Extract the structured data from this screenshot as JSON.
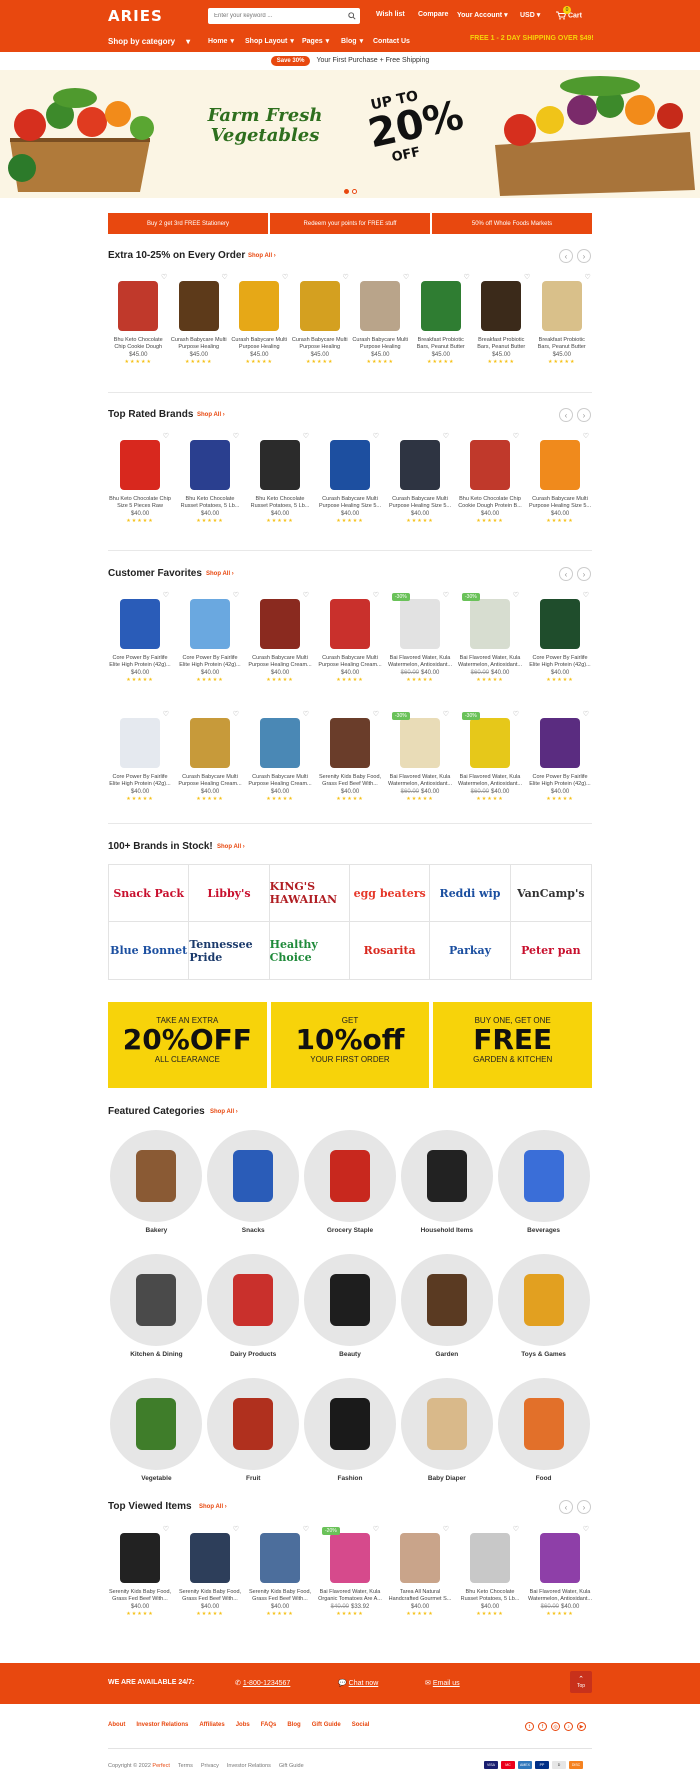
{
  "header": {
    "logo": "ARIES",
    "search_placeholder": "Enter your keyword ...",
    "links": [
      "Wish list",
      "Compare",
      "Your Account",
      "USD",
      "Cart"
    ],
    "cart_count": "0",
    "nav": [
      "Shop by category",
      "Home",
      "Shop Layout",
      "Pages",
      "Blog",
      "Contact Us"
    ],
    "shipping": "FREE 1 - 2 DAY SHIPPING OVER $49!"
  },
  "promo": {
    "badge": "Save 30%",
    "text": "Your First Purchase + Free Shipping"
  },
  "hero": {
    "line1": "Farm Fresh",
    "line2": "Vegetables",
    "up": "UP TO",
    "pct": "20%",
    "off": "OFF"
  },
  "tabs": [
    "Buy 2 get 3rd FREE Stationery",
    "Redeem your points for FREE stuff",
    "50% off Whole Foods Markets"
  ],
  "sections": {
    "extra": {
      "title": "Extra 10-25% on Every Order",
      "shop_all": "Shop All"
    },
    "top_rated": {
      "title": "Top Rated Brands",
      "shop_all": "Shop All"
    },
    "favorites": {
      "title": "Customer Favorites",
      "shop_all": "Shop All"
    },
    "brands": {
      "title": "100+ Brands in Stock!",
      "shop_all": "Shop All"
    },
    "featured": {
      "title": "Featured Categories",
      "shop_all": "Shop All"
    },
    "viewed": {
      "title": "Top Viewed Items",
      "shop_all": "Shop All"
    }
  },
  "row1": [
    {
      "name": "Bhu Keto Chocolate Chip Cookie Dough Protein B...",
      "price": "$45.00",
      "old": "",
      "badge": "",
      "color": "#c0392b"
    },
    {
      "name": "Curash Babycare Multi Purpose Healing Cream...",
      "price": "$45.00",
      "old": "",
      "badge": "",
      "color": "#5d3a1a"
    },
    {
      "name": "Curash Babycare Multi Purpose Healing Cream...",
      "price": "$45.00",
      "old": "",
      "badge": "",
      "color": "#e6a817"
    },
    {
      "name": "Curash Babycare Multi Purpose Healing Cream...",
      "price": "$45.00",
      "old": "",
      "badge": "",
      "color": "#d4a020"
    },
    {
      "name": "Curash Babycare Multi Purpose Healing Cream...",
      "price": "$45.00",
      "old": "",
      "badge": "",
      "color": "#b9a48a"
    },
    {
      "name": "Breakfast Probiotic Bars, Peanut Butter Dark...",
      "price": "$45.00",
      "old": "",
      "badge": "",
      "color": "#2f7d32"
    },
    {
      "name": "Breakfast Probiotic Bars, Peanut Butter Dark...",
      "price": "$45.00",
      "old": "",
      "badge": "",
      "color": "#3b2a1a"
    },
    {
      "name": "Breakfast Probiotic Bars, Peanut Butter Dark...",
      "price": "$45.00",
      "old": "",
      "badge": "",
      "color": "#d9c08a"
    }
  ],
  "row2": [
    {
      "name": "Bhu Keto Chocolate Chip Size 5 Pieces Raw (85g)...",
      "price": "$40.00",
      "old": "",
      "badge": "",
      "color": "#d8281e"
    },
    {
      "name": "Bhu Keto Chocolate Russet Potatoes, 5 Lb...",
      "price": "$40.00",
      "old": "",
      "badge": "",
      "color": "#2a3f8f"
    },
    {
      "name": "Bhu Keto Chocolate Russet Potatoes, 5 Lb...",
      "price": "$40.00",
      "old": "",
      "badge": "",
      "color": "#2b2b2b"
    },
    {
      "name": "Curash Babycare Multi Purpose Healing Size 5...",
      "price": "$40.00",
      "old": "",
      "badge": "",
      "color": "#1d4fa0"
    },
    {
      "name": "Curash Babycare Multi Purpose Healing Size 5...",
      "price": "$40.00",
      "old": "",
      "badge": "",
      "color": "#2e3442"
    },
    {
      "name": "Bhu Keto Chocolate Chip Cookie Dough Protein B...",
      "price": "$40.00",
      "old": "",
      "badge": "",
      "color": "#c0392b"
    },
    {
      "name": "Curash Babycare Multi Purpose Healing Size 5...",
      "price": "$40.00",
      "old": "",
      "badge": "",
      "color": "#f08a1c"
    }
  ],
  "row3": [
    {
      "name": "Core Power By Fairlife Elite High Protein (42g)...",
      "price": "$40.00",
      "old": "",
      "badge": "",
      "color": "#2a5cb8"
    },
    {
      "name": "Core Power By Fairlife Elite High Protein (42g)...",
      "price": "$40.00",
      "old": "",
      "badge": "",
      "color": "#6aa8e0"
    },
    {
      "name": "Curash Babycare Multi Purpose Healing Cream...",
      "price": "$40.00",
      "old": "",
      "badge": "",
      "color": "#8a2a1f"
    },
    {
      "name": "Curash Babycare Multi Purpose Healing Cream...",
      "price": "$40.00",
      "old": "",
      "badge": "",
      "color": "#c9302c"
    },
    {
      "name": "Bai Flavored Water, Kula Watermelon, Antioxidant...",
      "price": "$40.00",
      "old": "$60.00",
      "badge": "-30%",
      "color": "#e2e2e2"
    },
    {
      "name": "Bai Flavored Water, Kula Watermelon, Antioxidant...",
      "price": "$40.00",
      "old": "$60.00",
      "badge": "-30%",
      "color": "#d7ddd0"
    },
    {
      "name": "Core Power By Fairlife Elite High Protein (42g)...",
      "price": "$40.00",
      "old": "",
      "badge": "",
      "color": "#1f4d2c"
    }
  ],
  "row4": [
    {
      "name": "Core Power By Fairlife Elite High Protein (42g)...",
      "price": "$40.00",
      "old": "",
      "badge": "",
      "color": "#e5e9ef"
    },
    {
      "name": "Curash Babycare Multi Purpose Healing Cream...",
      "price": "$40.00",
      "old": "",
      "badge": "",
      "color": "#c79a3a"
    },
    {
      "name": "Curash Babycare Multi Purpose Healing Cream...",
      "price": "$40.00",
      "old": "",
      "badge": "",
      "color": "#4a88b5"
    },
    {
      "name": "Serenity Kids Baby Food, Grass Fed Beef With...",
      "price": "$40.00",
      "old": "",
      "badge": "",
      "color": "#6a3d2a"
    },
    {
      "name": "Bai Flavored Water, Kula Watermelon, Antioxidant...",
      "price": "$40.00",
      "old": "$60.00",
      "badge": "-30%",
      "color": "#e9dcb7"
    },
    {
      "name": "Bai Flavored Water, Kula Watermelon, Antioxidant...",
      "price": "$40.00",
      "old": "$60.00",
      "badge": "-30%",
      "color": "#e6c81a"
    },
    {
      "name": "Core Power By Fairlife Elite High Protein (42g)...",
      "price": "$40.00",
      "old": "",
      "badge": "",
      "color": "#5a2c80"
    }
  ],
  "row5": [
    {
      "name": "Serenity Kids Baby Food, Grass Fed Beef With...",
      "price": "$40.00",
      "old": "",
      "badge": "",
      "color": "#222222"
    },
    {
      "name": "Serenity Kids Baby Food, Grass Fed Beef With...",
      "price": "$40.00",
      "old": "",
      "badge": "",
      "color": "#2d3e5a"
    },
    {
      "name": "Serenity Kids Baby Food, Grass Fed Beef With...",
      "price": "$40.00",
      "old": "",
      "badge": "",
      "color": "#4c6e9c"
    },
    {
      "name": "Bai Flavored Water, Kula Organic Tomatoes Are A...",
      "price": "$33.92",
      "old": "$40.00",
      "badge": "-20%",
      "color": "#d64a8c"
    },
    {
      "name": "Tarea All Natural Handcrafted Gourmet S...",
      "price": "$40.00",
      "old": "",
      "badge": "",
      "color": "#c9a48a"
    },
    {
      "name": "Bhu Keto Chocolate Russet Potatoes, 5 Lb...",
      "price": "$40.00",
      "old": "",
      "badge": "",
      "color": "#c8c8c8"
    },
    {
      "name": "Bai Flavored Water, Kula Watermelon, Antioxidant...",
      "price": "$40.00",
      "old": "$60.00",
      "badge": "",
      "color": "#8e3fa8"
    }
  ],
  "brands": [
    {
      "name": "Snack Pack",
      "color": "#c8102e"
    },
    {
      "name": "Libby's",
      "color": "#c8102e"
    },
    {
      "name": "KING'S HAWAIIAN",
      "color": "#b01e23"
    },
    {
      "name": "egg beaters",
      "color": "#e6392b"
    },
    {
      "name": "Reddi wip",
      "color": "#1b4fa0"
    },
    {
      "name": "VanCamp's",
      "color": "#333333"
    },
    {
      "name": "Blue Bonnet",
      "color": "#1b4fa0"
    },
    {
      "name": "Tennessee Pride",
      "color": "#1b3a6b"
    },
    {
      "name": "Healthy Choice",
      "color": "#1f8a3a"
    },
    {
      "name": "Rosarita",
      "color": "#d9281e"
    },
    {
      "name": "Parkay",
      "color": "#1b4fa0"
    },
    {
      "name": "Peter pan",
      "color": "#c8102e"
    }
  ],
  "offers": [
    {
      "l1": "TAKE AN EXTRA",
      "l2": "20%OFF",
      "l3": "ALL CLEARANCE"
    },
    {
      "l1": "GET",
      "l2": "10%off",
      "l3": "YOUR FIRST ORDER"
    },
    {
      "l1": "BUY ONE, GET ONE",
      "l2": "FREE",
      "l3": "GARDEN & KITCHEN"
    }
  ],
  "categories": [
    {
      "label": "Bakery",
      "color": "#8a5a34"
    },
    {
      "label": "Snacks",
      "color": "#2a5cb8"
    },
    {
      "label": "Grocery Staple",
      "color": "#c8281e"
    },
    {
      "label": "Household Items",
      "color": "#222222"
    },
    {
      "label": "Beverages",
      "color": "#3a6ed8"
    },
    {
      "label": "Kitchen & Dining",
      "color": "#4a4a4a"
    },
    {
      "label": "Dairy Products",
      "color": "#c9302c"
    },
    {
      "label": "Beauty",
      "color": "#1e1e1e"
    },
    {
      "label": "Garden",
      "color": "#5a3a22"
    },
    {
      "label": "Toys & Games",
      "color": "#e2a020"
    },
    {
      "label": "Vegetable",
      "color": "#3f7d2a"
    },
    {
      "label": "Fruit",
      "color": "#b0301e"
    },
    {
      "label": "Fashion",
      "color": "#1a1a1a"
    },
    {
      "label": "Baby Diaper",
      "color": "#d9b98a"
    },
    {
      "label": "Food",
      "color": "#e2702a"
    }
  ],
  "footer": {
    "available": "WE ARE AVAILABLE 24/7:",
    "phone": "1-800-1234567",
    "chat": "Chat now",
    "email": "Email us",
    "top": "Top",
    "links": [
      "About",
      "Investor Relations",
      "Affiliates",
      "Jobs",
      "FAQs",
      "Blog",
      "Gift Guide",
      "Social"
    ],
    "copyright": "Copyright © 2022",
    "brand": "Perfect",
    "bottom_links": [
      "Terms",
      "Privacy",
      "Investor Relations",
      "Gift Guide"
    ],
    "pay": [
      "VISA",
      "MC",
      "AMEX",
      "PP",
      "D",
      "DISC"
    ]
  }
}
